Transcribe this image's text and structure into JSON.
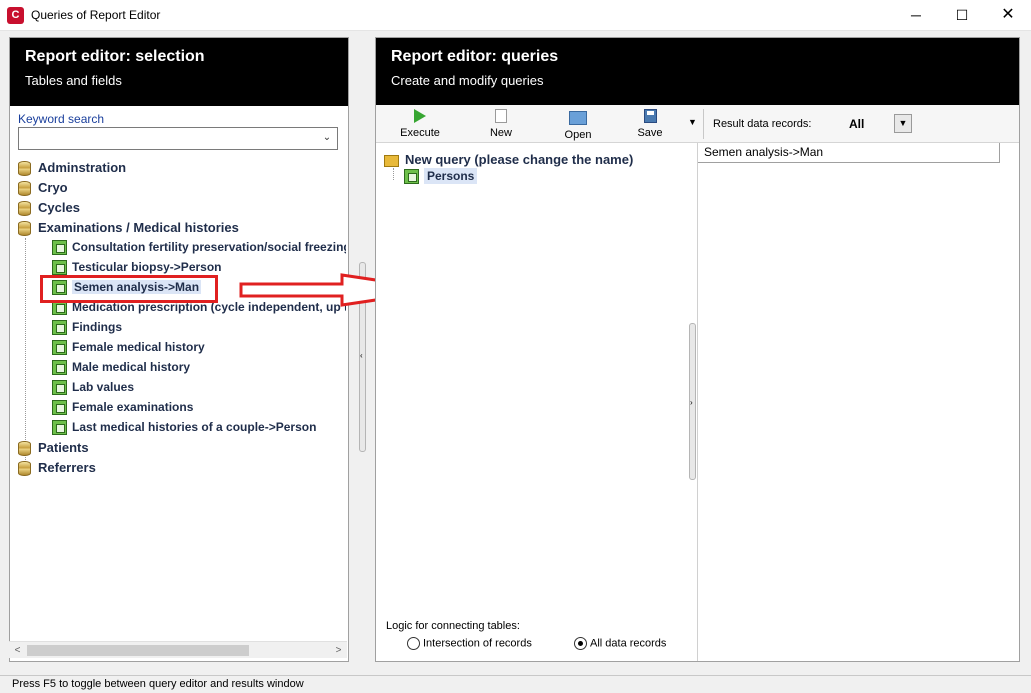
{
  "window": {
    "title": "Queries of Report Editor",
    "app_icon_glyph": "C",
    "minimize_glyph": "─",
    "maximize_glyph": "☐",
    "close_glyph": "✕"
  },
  "left_panel": {
    "title": "Report editor: selection",
    "subtitle": "Tables and fields",
    "keyword_search": {
      "label": "Keyword search",
      "value": "",
      "dropdown_glyph": "⌄"
    },
    "tree": {
      "categories": [
        {
          "label": "Adminstration"
        },
        {
          "label": "Cryo"
        },
        {
          "label": "Cycles"
        },
        {
          "label": "Examinations / Medical histories"
        }
      ],
      "children": [
        {
          "label": "Consultation fertility preservation/social freezing"
        },
        {
          "label": "Testicular biopsy->Person"
        },
        {
          "label": "Semen analysis->Man",
          "selected": true
        },
        {
          "label": "Medication prescription (cycle independent, up to"
        },
        {
          "label": "Findings"
        },
        {
          "label": "Female medical history"
        },
        {
          "label": "Male medical history"
        },
        {
          "label": "Lab values"
        },
        {
          "label": "Female examinations"
        },
        {
          "label": "Last medical histories of a couple->Person"
        }
      ],
      "categories_after": [
        {
          "label": "Patients"
        },
        {
          "label": "Referrers"
        }
      ]
    },
    "scroll_left_glyph": "<",
    "scroll_right_glyph": ">"
  },
  "splitter": {
    "collapse_left_glyph": "‹",
    "collapse_right_glyph": "›"
  },
  "right_panel": {
    "title": "Report editor: queries",
    "subtitle": "Create and modify queries",
    "toolbar": {
      "execute_label": "Execute",
      "new_label": "New",
      "open_label": "Open",
      "save_label": "Save",
      "more_glyph": "▼"
    },
    "result_records": {
      "label": "Result data records:",
      "value": "All",
      "dropdown_glyph": "▼"
    },
    "query_tree": {
      "root_label": "New query (please change the name)",
      "child_label": "Persons"
    },
    "grid": {
      "column_header": "Semen analysis->Man"
    },
    "logic": {
      "label": "Logic for connecting tables:",
      "options": [
        {
          "label": "Intersection of records",
          "selected": false
        },
        {
          "label": "All data records",
          "selected": true
        }
      ]
    }
  },
  "status_bar": {
    "text": "Press F5 to toggle between query editor and results window"
  },
  "colors": {
    "header_bg": "#000000",
    "highlight_border": "#e02020",
    "tree_text": "#1f2d4a",
    "selection_bg": "#dbe5f6"
  }
}
